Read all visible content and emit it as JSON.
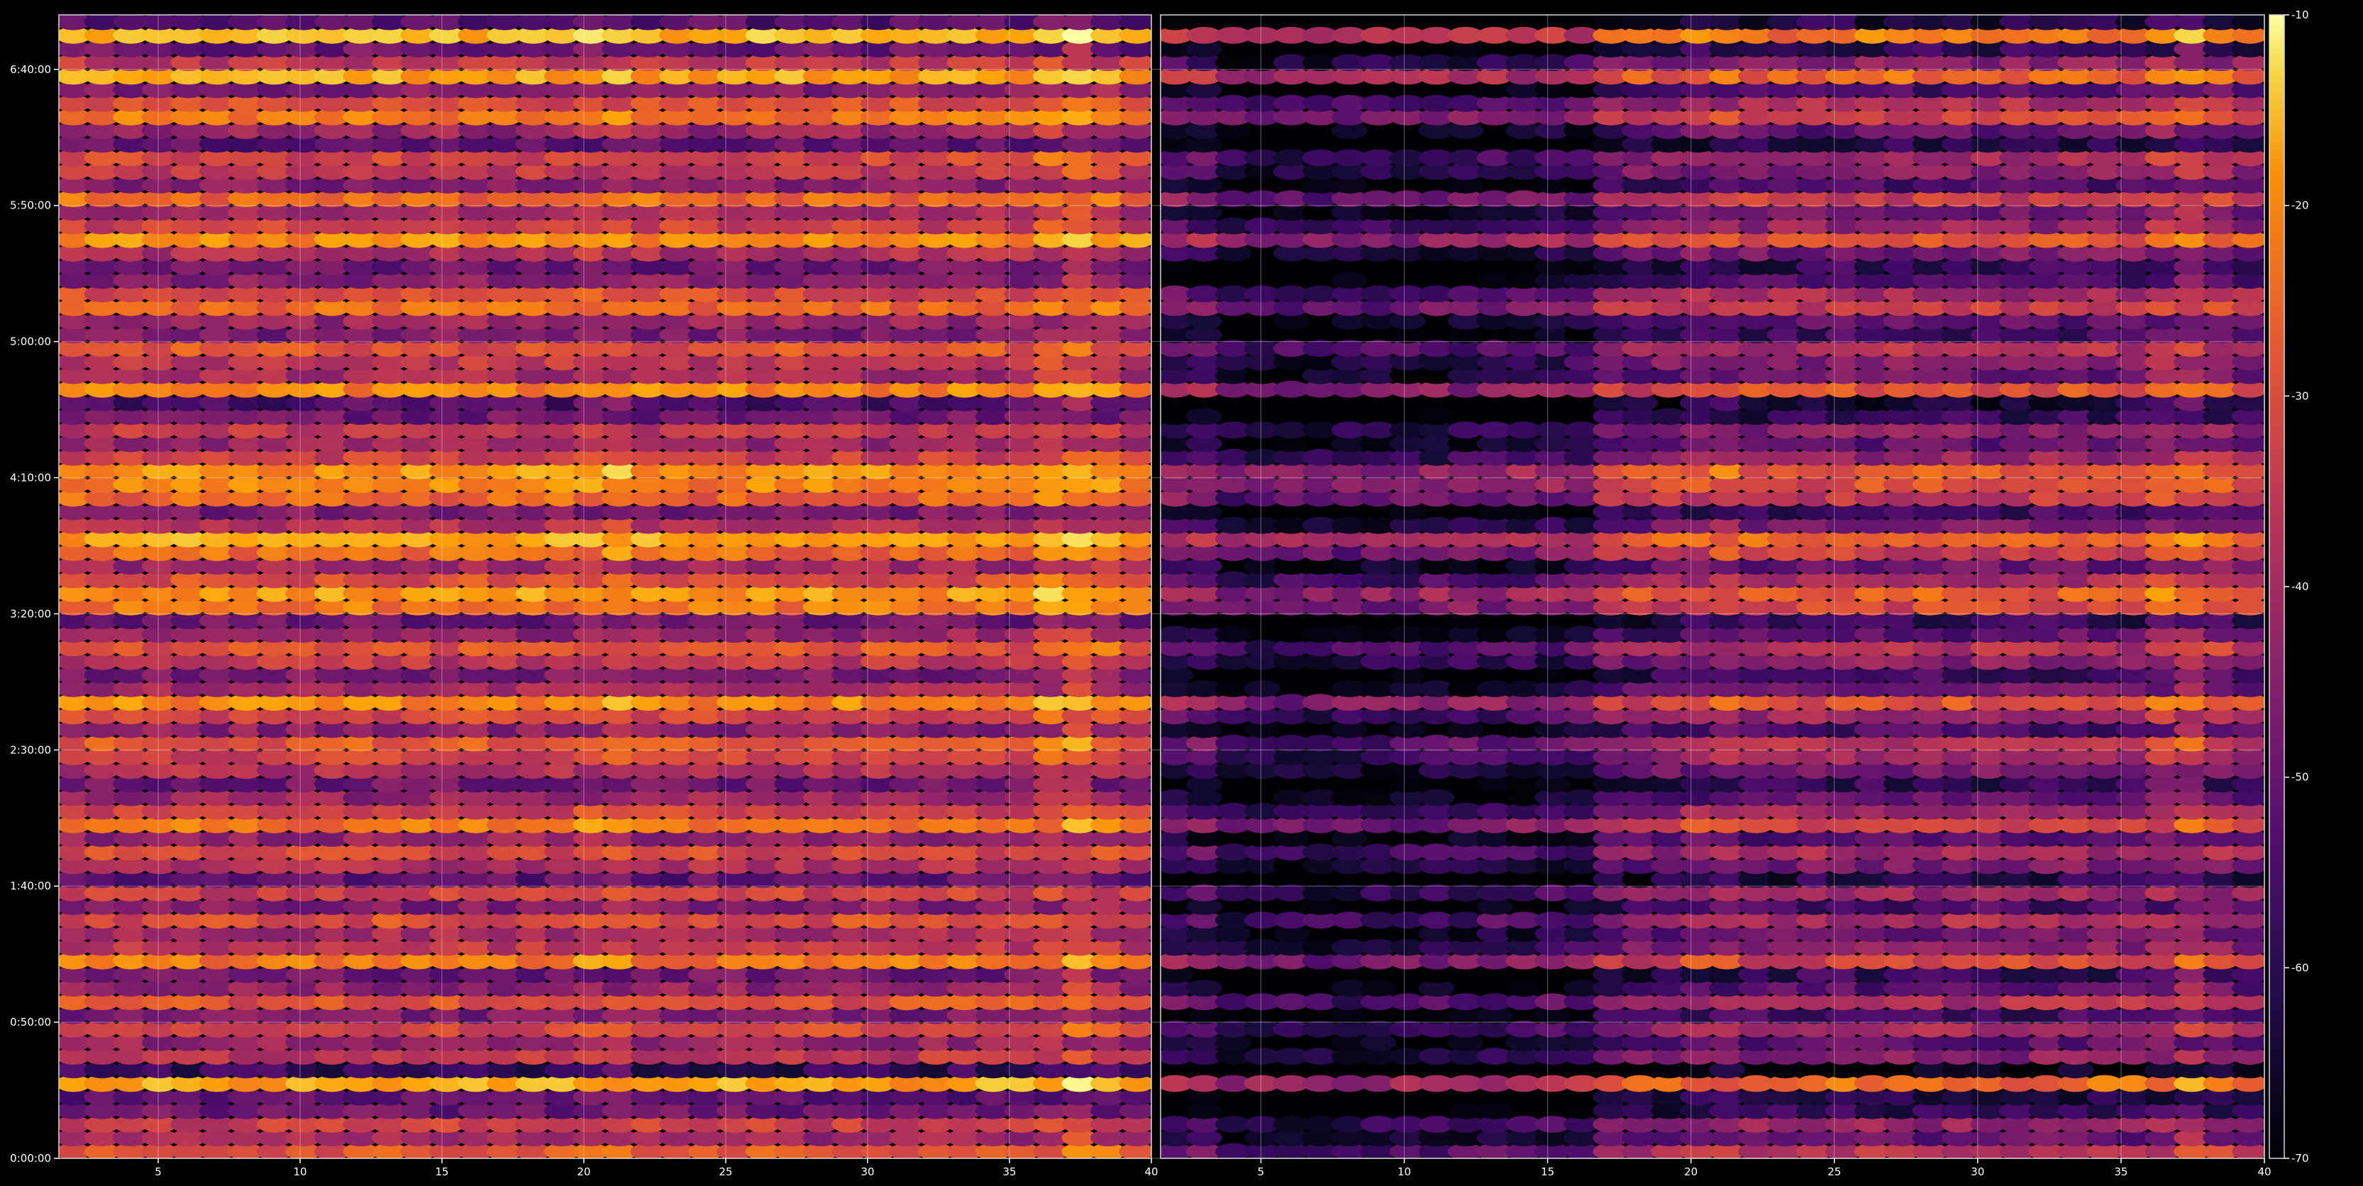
{
  "chart_data": {
    "type": "heatmap",
    "colormap": "inferno",
    "background": "#000000",
    "grid": true,
    "panels": [
      {
        "name": "",
        "x_ticks": [
          "5",
          "10",
          "15",
          "20",
          "25",
          "30",
          "35",
          "40"
        ],
        "xlim": [
          1.5,
          40
        ]
      },
      {
        "name": "",
        "x_ticks": [
          "5",
          "10",
          "15",
          "20",
          "25",
          "30",
          "35",
          "40"
        ],
        "xlim": [
          1.5,
          40
        ]
      }
    ],
    "y_ticks": [
      "0:00:00",
      "0:50:00",
      "1:40:00",
      "2:30:00",
      "3:20:00",
      "4:10:00",
      "5:00:00",
      "5:50:00",
      "6:40:00"
    ],
    "y_tick_seconds": [
      0,
      3000,
      6000,
      9000,
      12000,
      15000,
      18000,
      21000,
      24000
    ],
    "ylim_seconds": [
      0,
      25200
    ],
    "colorbar": {
      "ticks": [
        "-10",
        "-20",
        "-30",
        "-40",
        "-50",
        "-60",
        "-70"
      ],
      "range": [
        -70,
        -10
      ]
    },
    "rows": 84,
    "cols": 38,
    "row_profile_db": [
      -33,
      -45,
      -38,
      -52,
      -55,
      -22,
      -60,
      -40,
      -46,
      -36,
      -50,
      -34,
      -47,
      -52,
      -28,
      -40,
      -44,
      -35,
      -49,
      -38,
      -54,
      -42,
      -36,
      -47,
      -29,
      -37,
      -46,
      -52,
      -42,
      -38,
      -33,
      -48,
      -36,
      -26,
      -44,
      -50,
      -40,
      -34,
      -46,
      -52,
      -28,
      -24,
      -35,
      -45,
      -30,
      -22,
      -42,
      -50,
      -31,
      -27,
      -24,
      -38,
      -46,
      -40,
      -52,
      -56,
      -26,
      -44,
      -40,
      -34,
      -50,
      -46,
      -30,
      -36,
      -48,
      -52,
      -42,
      -25,
      -38,
      -44,
      -30,
      -49,
      -40,
      -36,
      -54,
      -46,
      -28,
      -35,
      -49,
      -22,
      -40,
      -52,
      -20,
      -55
    ],
    "right_panel_offset_db": -18,
    "right_panel_quiet_band_cols": [
      2,
      14
    ]
  }
}
